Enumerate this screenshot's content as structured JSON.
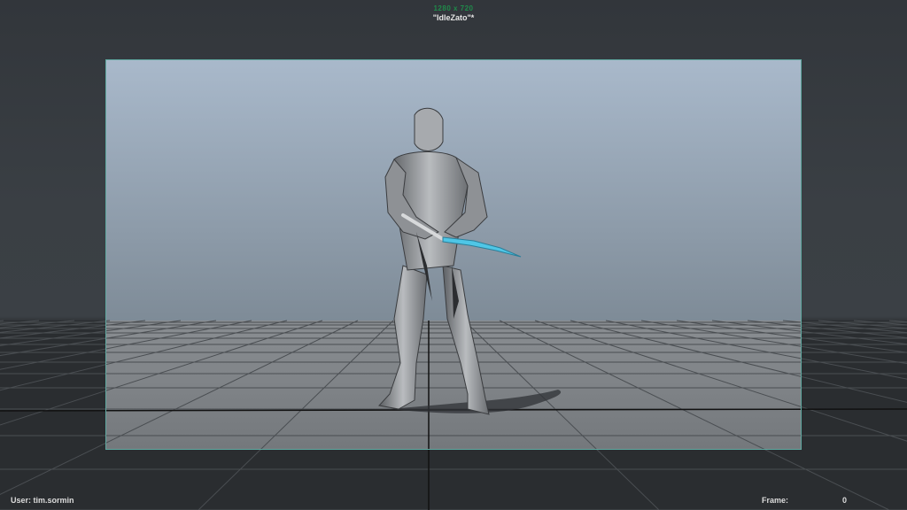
{
  "hud": {
    "resolution": "1280 x 720",
    "camera_name": "\"IdleZato\"*",
    "user_label": "User: tim.sormin",
    "frame_label": "Frame:",
    "frame_value": "0"
  },
  "scene": {
    "character": "warframe-excalibur-like-figure",
    "weapon": "glowing-blue-katana",
    "sky_top_color": "#a7b7c9",
    "sky_bottom_color": "#7f8c98",
    "floor_color": "#7b7f83",
    "grid_line_color": "#3e4246",
    "gate_border_color": "#5fa8a0",
    "blade_color": "#4fc6e6"
  }
}
